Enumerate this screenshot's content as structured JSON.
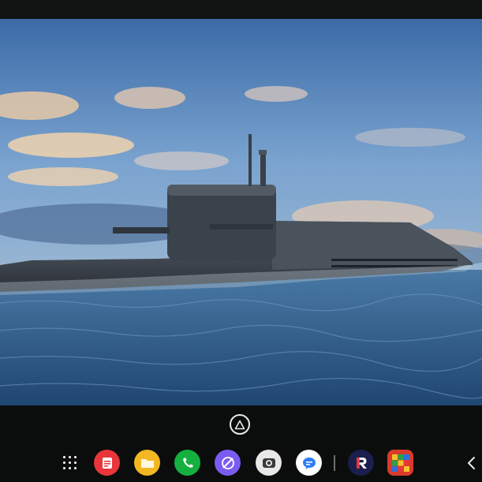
{
  "wallpaper": {
    "subject": "submarine-at-sea",
    "colors": {
      "sky_top": "#3b6aa6",
      "sky_mid": "#7aa3cf",
      "cloud": "#e8c59a",
      "sea": "#2f5c88",
      "hull": "#3e4650"
    }
  },
  "navigation": {
    "home_icon": "home-circle-icon",
    "back_icon": "chevron-left-icon"
  },
  "dock": {
    "apps": [
      {
        "icon": "notes-icon",
        "color": "#e8363a"
      },
      {
        "icon": "folder-icon",
        "color": "#f2b722"
      },
      {
        "icon": "phone-icon",
        "color": "#15b03f"
      },
      {
        "icon": "browser-icon",
        "color": "#7b5cf0"
      },
      {
        "icon": "camera-icon",
        "color": "#e8e8e8"
      },
      {
        "icon": "messages-icon",
        "color": "#ffffff"
      },
      {
        "icon": "r-app-icon",
        "color": "#1b1f4e"
      },
      {
        "icon": "game-grid-icon",
        "color": "#d93a2b"
      }
    ]
  }
}
